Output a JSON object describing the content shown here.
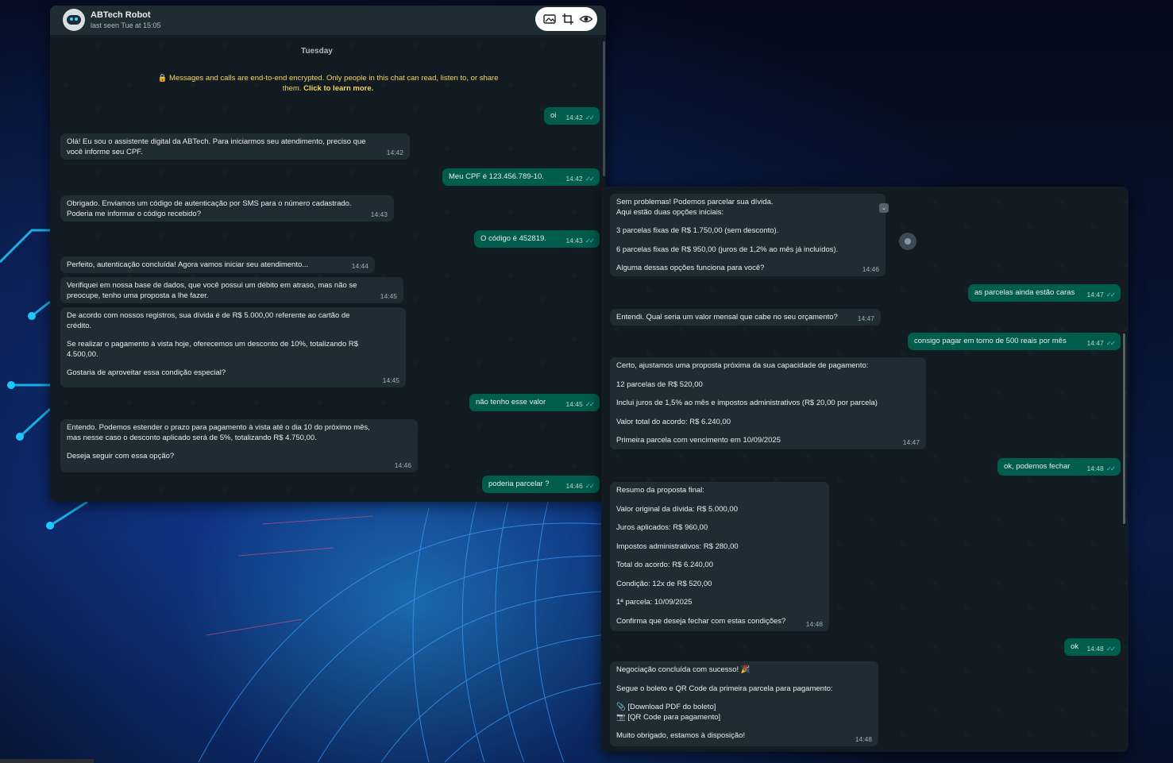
{
  "contact": {
    "name": "ABTech Robot",
    "status": "last seen Tue at 15:05"
  },
  "toolbar": {
    "image_icon": "image-icon",
    "crop_icon": "crop-icon",
    "view_icon": "eye-icon"
  },
  "day_label": "Tuesday",
  "encryption": {
    "text": "Messages and calls are end-to-end encrypted. Only people in this chat can read, listen to, or share them.",
    "link": "Click to learn more."
  },
  "colors": {
    "incoming": "#202c33",
    "outgoing": "#005c4b",
    "chat_bg": "#111b21",
    "read_tick": "#53bdeb",
    "notice": "#f7d55b"
  },
  "tick": "✓✓",
  "chat1": [
    {
      "dir": "out",
      "lines": [
        "oi"
      ],
      "time": "14:42"
    },
    {
      "dir": "in",
      "lines": [
        "Olá! Eu sou o assistente digital da ABTech. Para iniciarmos seu atendimento, preciso que",
        "você informe seu CPF."
      ],
      "time": "14:42"
    },
    {
      "dir": "out",
      "lines": [
        "Meu CPF é 123.456.789-10."
      ],
      "time": "14:42"
    },
    {
      "dir": "in",
      "lines": [
        "Obrigado. Enviamos um código de autenticação por SMS para o número cadastrado.",
        "Poderia me informar o código recebido?"
      ],
      "time": "14:43"
    },
    {
      "dir": "out",
      "lines": [
        "O código é 452819."
      ],
      "time": "14:43"
    },
    {
      "dir": "in",
      "lines": [
        "Perfeito, autenticação concluída! Agora vamos iniciar seu atendimento..."
      ],
      "time": "14:44"
    },
    {
      "dir": "in",
      "lines": [
        "Verifiquei em nossa base de dados, que você possui um débito em atraso, mas não se",
        "preocupe, tenho uma proposta a lhe fazer."
      ],
      "time": "14:45"
    },
    {
      "dir": "in",
      "lines": [
        "De acordo com nossos registros, sua dívida é de R$ 5.000,00 referente ao cartão de",
        "crédito.",
        "",
        "Se realizar o pagamento à vista hoje, oferecemos um desconto de 10%, totalizando R$",
        "4.500,00.",
        "",
        "Gostaria de aproveitar essa condição especial?"
      ],
      "time": "14:45"
    },
    {
      "dir": "out",
      "lines": [
        "não tenho esse valor"
      ],
      "time": "14:45"
    },
    {
      "dir": "in",
      "lines": [
        "Entendo. Podemos estender o prazo para pagamento à vista até o dia 10 do próximo mês,",
        "mas nesse caso o desconto aplicado será de 5%, totalizando R$ 4.750,00.",
        "",
        "Deseja seguir com essa opção?"
      ],
      "time": "14:46"
    },
    {
      "dir": "out",
      "lines": [
        "poderia parcelar ?"
      ],
      "time": "14:46"
    }
  ],
  "chat2": [
    {
      "dir": "in",
      "lines": [
        "Sem problemas! Podemos parcelar sua dívida.",
        "Aqui estão duas opções iniciais:",
        "",
        "3 parcelas fixas de R$ 1.750,00 (sem desconto).",
        "",
        "6 parcelas fixas de R$ 950,00 (juros de 1,2% ao mês já incluídos).",
        "",
        "Alguma dessas opções funciona para você?"
      ],
      "time": "14:46"
    },
    {
      "dir": "out",
      "lines": [
        "as parcelas ainda estão caras"
      ],
      "time": "14:47"
    },
    {
      "dir": "in",
      "lines": [
        "Entendi. Qual seria um valor mensal que cabe no seu orçamento?"
      ],
      "time": "14:47"
    },
    {
      "dir": "out",
      "lines": [
        "consigo pagar em torno de 500 reais por mês"
      ],
      "time": "14:47"
    },
    {
      "dir": "in",
      "lines": [
        "Certo, ajustamos uma proposta próxima da sua capacidade de pagamento:",
        "",
        "12 parcelas de R$ 520,00",
        "",
        "Inclui juros de 1,5% ao mês e impostos administrativos (R$ 20,00 por parcela)",
        "",
        "Valor total do acordo: R$ 6.240,00",
        "",
        "Primeira parcela com vencimento em 10/09/2025"
      ],
      "time": "14:47"
    },
    {
      "dir": "out",
      "lines": [
        "ok, podemos fechar"
      ],
      "time": "14:48"
    },
    {
      "dir": "in",
      "lines": [
        "Resumo da proposta final:",
        "",
        "Valor original da dívida: R$ 5.000,00",
        "",
        "Juros aplicados: R$ 960,00",
        "",
        "Impostos administrativos: R$ 280,00",
        "",
        "Total do acordo: R$ 6.240,00",
        "",
        "Condição: 12x de R$ 520,00",
        "",
        "1ª parcela: 10/09/2025",
        "",
        "Confirma que deseja fechar com estas condições?"
      ],
      "time": "14:48"
    },
    {
      "dir": "out",
      "lines": [
        "ok"
      ],
      "time": "14:48"
    },
    {
      "dir": "in",
      "lines": [
        "Negociação concluída com sucesso! 🎉",
        "",
        "Segue o boleto e QR Code da primeira parcela para pagamento:",
        "",
        "📎 [Download PDF do boleto]",
        "📷 [QR Code para pagamento]",
        "",
        "Muito obrigado, estamos à disposição!"
      ],
      "time": "14:48"
    }
  ]
}
